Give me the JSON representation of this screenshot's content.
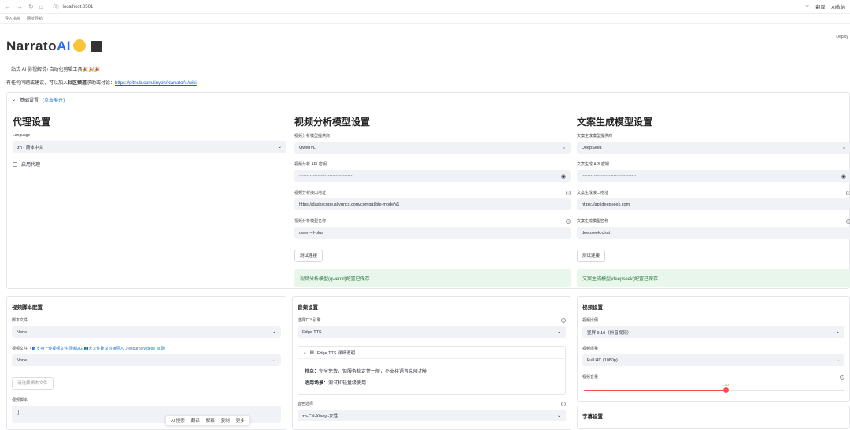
{
  "browser": {
    "url": "localhost:8501",
    "toolbar": [
      "翻译",
      "AI收纳"
    ],
    "bookmarks": [
      "导入书签",
      "网址导航"
    ]
  },
  "app": {
    "deploy": "Deploy",
    "brand_main": "Narrato",
    "brand_ai": "AI",
    "subtitle": "一站式 AI 影视解说+自动化剪辑工具🎉🎉🎉",
    "contact_prefix": "有任何问题或建议，可以加入",
    "contact_bold": "社区频道",
    "contact_mid": "求助或讨论：",
    "contact_link": "https://github.com/linyoh/NarratoAI/wiki"
  },
  "basic": {
    "title": "基础设置",
    "hint": "(点击展开)",
    "proxy": {
      "heading": "代理设置",
      "language_label": "Language",
      "language_value": "zh - 简体中文",
      "enable_proxy": "启用代理"
    },
    "vision": {
      "heading": "视频分析模型设置",
      "provider_label": "视频分析模型提供商",
      "provider_value": "QwenVL",
      "key_label": "视频分析 API 密钥",
      "key_value": "••••••••••••••••••••••••••••••••••••",
      "url_label": "视频分析接口地址",
      "url_value": "https://dashscope.aliyuncs.com/compatible-mode/v1",
      "model_label": "视频分析模型名称",
      "model_value": "qwen-vl-plus",
      "test_btn": "测试连接",
      "saved": "视频分析模型(qwenvl)配置已保存"
    },
    "text": {
      "heading": "文案生成模型设置",
      "provider_label": "文案生成模型提供商",
      "provider_value": "DeepSeek",
      "key_label": "文案生成 API 密钥",
      "key_value": "••••••••••••••••••••••••••••••••••••",
      "url_label": "文案生成接口地址",
      "url_value": "https://api.deepseek.com",
      "model_label": "文案生成模型名称",
      "model_value": "deepseek-chat",
      "test_btn": "测试连接",
      "saved": "文案生成模型(deepseek)配置已保存"
    }
  },
  "script_card": {
    "title": "视频脚本配置",
    "script_file_label": "脚本文件",
    "script_file_value": "None",
    "video_file_prefix": "视频文件（",
    "video_file_tag1": "1",
    "video_file_mid": "支持上传视频文件(限制2G)",
    "video_file_tag2": "2",
    "video_file_end": "大文件建议直接导入 ./resource/videos 目录）",
    "video_file_value": "None",
    "choose_btn": "请选择脚本文件",
    "video_script_label": "视频脚本",
    "video_script_value": "[]"
  },
  "audio_card": {
    "title": "音频设置",
    "tts_label": "选择TTS引擎",
    "tts_value": "Edge TTS",
    "detail_title": "Edge TTS 详细说明",
    "feature_label": "特点：",
    "feature_text": "完全免费，但服务稳定性一般，不支持语音克隆功能",
    "scene_label": "适用场景：",
    "scene_text": "测试和轻量级使用",
    "voice_label": "音色选择",
    "voice_value": "zh-CN-Xiaoyi-女性"
  },
  "video_card": {
    "title": "视频设置",
    "ratio_label": "视频比例",
    "ratio_value": "竖屏 9:16（抖音视频）",
    "quality_label": "视频质量",
    "quality_value": "Full HD (1080p)",
    "volume_label": "视频音量",
    "volume_value": "1.10",
    "volume_fraction": 0.55
  },
  "subtitle_card": {
    "title": "字幕设置"
  },
  "floatbar": [
    "AI 搜索",
    "翻译",
    "解释",
    "复制",
    "更多"
  ]
}
